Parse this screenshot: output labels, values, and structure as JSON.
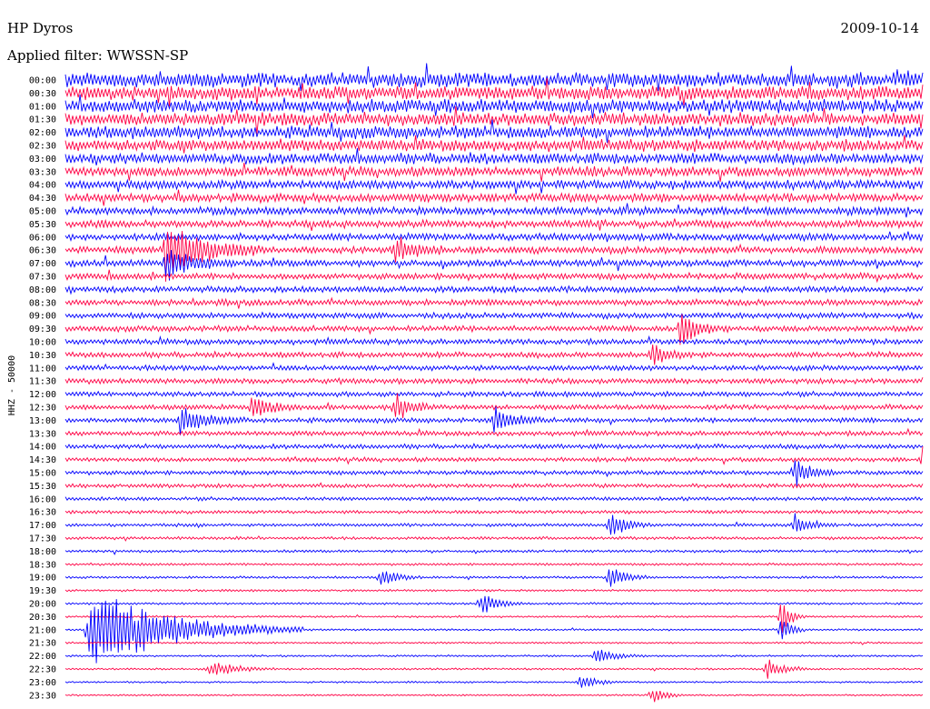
{
  "header": {
    "station": "HP Dyros",
    "date": "2009-10-14",
    "filter": "Applied filter: WWSSN-SP"
  },
  "chart_data": {
    "type": "helicorder",
    "channel_label": "HHZ - 50000",
    "row_labels": [
      "00:00",
      "00:30",
      "01:00",
      "01:30",
      "02:00",
      "02:30",
      "03:00",
      "03:30",
      "04:00",
      "04:30",
      "05:00",
      "05:30",
      "06:00",
      "06:30",
      "07:00",
      "07:30",
      "08:00",
      "08:30",
      "09:00",
      "09:30",
      "10:00",
      "10:30",
      "11:00",
      "11:30",
      "12:00",
      "12:30",
      "13:00",
      "13:30",
      "14:00",
      "14:30",
      "15:00",
      "15:30",
      "16:00",
      "16:30",
      "17:00",
      "17:30",
      "18:00",
      "18:30",
      "19:00",
      "19:30",
      "20:00",
      "20:30",
      "21:00",
      "21:30",
      "22:00",
      "22:30",
      "23:00",
      "23:30"
    ],
    "row_minutes": 30,
    "colors": [
      "#0000ff",
      "#ff0044"
    ],
    "noise_level": [
      1.0,
      0.95,
      0.92,
      0.9,
      0.86,
      0.8,
      0.74,
      0.68,
      0.62,
      0.58,
      0.55,
      0.52,
      0.5,
      0.48,
      0.46,
      0.44,
      0.42,
      0.42,
      0.4,
      0.4,
      0.38,
      0.38,
      0.36,
      0.36,
      0.35,
      0.35,
      0.34,
      0.33,
      0.32,
      0.3,
      0.3,
      0.28,
      0.26,
      0.24,
      0.22,
      0.2,
      0.18,
      0.17,
      0.16,
      0.15,
      0.15,
      0.14,
      0.14,
      0.13,
      0.13,
      0.13,
      0.12,
      0.12
    ],
    "events": [
      {
        "row": 13,
        "minute": 3.5,
        "amplitude": 4.0,
        "duration_min": 1.2
      },
      {
        "row": 13,
        "minute": 11.5,
        "amplitude": 2.0,
        "duration_min": 0.6
      },
      {
        "row": 14,
        "minute": 3.5,
        "amplitude": 2.5,
        "duration_min": 0.8
      },
      {
        "row": 19,
        "minute": 21.5,
        "amplitude": 2.2,
        "duration_min": 0.6
      },
      {
        "row": 21,
        "minute": 20.5,
        "amplitude": 1.8,
        "duration_min": 0.5
      },
      {
        "row": 25,
        "minute": 6.5,
        "amplitude": 1.8,
        "duration_min": 0.6
      },
      {
        "row": 25,
        "minute": 11.5,
        "amplitude": 2.0,
        "duration_min": 0.5
      },
      {
        "row": 26,
        "minute": 4.0,
        "amplitude": 2.0,
        "duration_min": 0.8
      },
      {
        "row": 26,
        "minute": 15.0,
        "amplitude": 1.8,
        "duration_min": 0.6
      },
      {
        "row": 29,
        "minute": 30.0,
        "amplitude": 2.0,
        "duration_min": 0.6
      },
      {
        "row": 30,
        "minute": 25.5,
        "amplitude": 2.0,
        "duration_min": 0.5
      },
      {
        "row": 34,
        "minute": 19.0,
        "amplitude": 1.8,
        "duration_min": 0.5
      },
      {
        "row": 34,
        "minute": 25.5,
        "amplitude": 1.5,
        "duration_min": 0.5
      },
      {
        "row": 38,
        "minute": 11.0,
        "amplitude": 1.5,
        "duration_min": 0.5
      },
      {
        "row": 38,
        "minute": 19.0,
        "amplitude": 1.8,
        "duration_min": 0.5
      },
      {
        "row": 40,
        "minute": 14.5,
        "amplitude": 2.0,
        "duration_min": 0.5
      },
      {
        "row": 41,
        "minute": 25.0,
        "amplitude": 3.0,
        "duration_min": 0.3
      },
      {
        "row": 42,
        "minute": 0.8,
        "amplitude": 6.0,
        "duration_min": 2.5
      },
      {
        "row": 42,
        "minute": 25.0,
        "amplitude": 2.5,
        "duration_min": 0.3
      },
      {
        "row": 44,
        "minute": 18.5,
        "amplitude": 1.2,
        "duration_min": 0.6
      },
      {
        "row": 45,
        "minute": 5.0,
        "amplitude": 1.2,
        "duration_min": 0.8
      },
      {
        "row": 45,
        "minute": 24.5,
        "amplitude": 1.5,
        "duration_min": 0.5
      },
      {
        "row": 46,
        "minute": 18.0,
        "amplitude": 1.2,
        "duration_min": 0.5
      },
      {
        "row": 47,
        "minute": 20.5,
        "amplitude": 1.5,
        "duration_min": 0.4
      }
    ]
  }
}
